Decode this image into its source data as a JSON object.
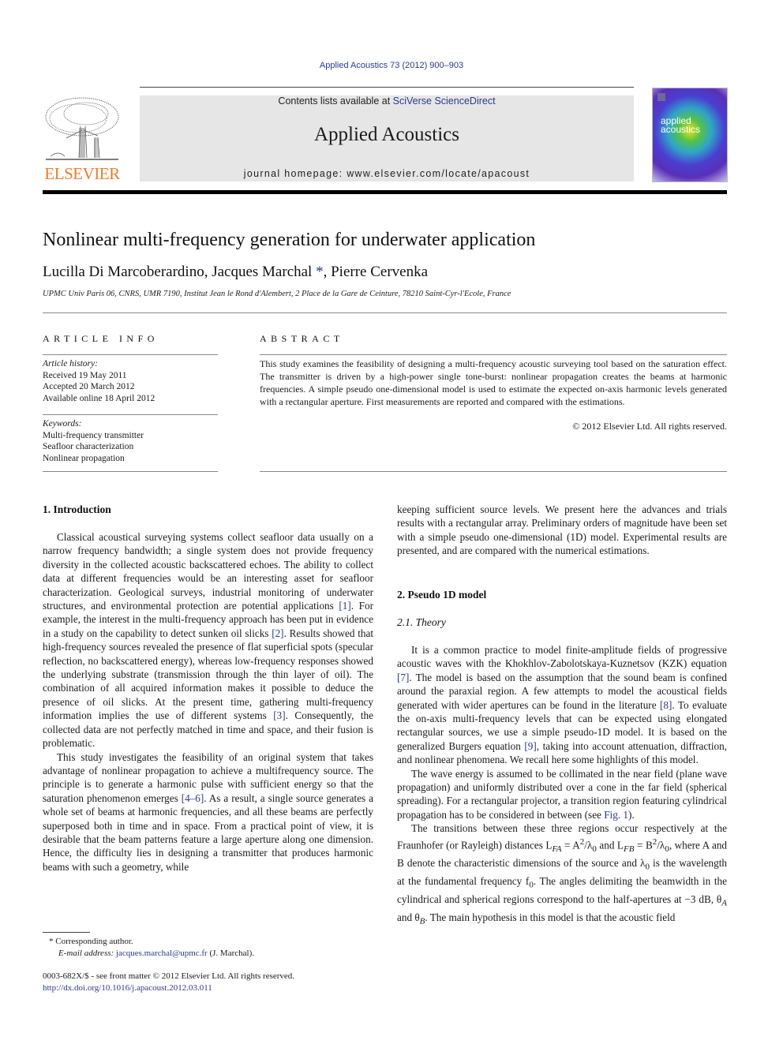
{
  "header": {
    "citation": "Applied Acoustics 73 (2012) 900–903",
    "publisher": "ELSEVIER",
    "contents_prefix": "Contents lists available at ",
    "contents_link": "SciVerse ScienceDirect",
    "journal_title": "Applied Acoustics",
    "homepage_prefix": "journal homepage: ",
    "homepage_url": "www.elsevier.com/locate/apacoust",
    "cover_title_line1": "applied",
    "cover_title_line2": "acoustics"
  },
  "article": {
    "title": "Nonlinear multi-frequency generation for underwater application",
    "authors": [
      {
        "name": "Lucilla Di Marcoberardino",
        "suffix": ", "
      },
      {
        "name": "Jacques Marchal",
        "mark": " *",
        "suffix": ", "
      },
      {
        "name": "Pierre Cervenka",
        "suffix": ""
      }
    ],
    "affiliation": "UPMC Univ Paris 06, CNRS, UMR 7190, Institut Jean le Rond d'Alembert, 2 Place de la Gare de Ceinture, 78210 Saint-Cyr-l'Ecole, France"
  },
  "article_info": {
    "heading": "ARTICLE INFO",
    "history_label": "Article history:",
    "history": [
      "Received 19 May 2011",
      "Accepted 20 March 2012",
      "Available online 18 April 2012"
    ],
    "keywords_label": "Keywords:",
    "keywords": [
      "Multi-frequency transmitter",
      "Seafloor characterization",
      "Nonlinear propagation"
    ]
  },
  "abstract": {
    "heading": "ABSTRACT",
    "text": "This study examines the feasibility of designing a multi-frequency acoustic surveying tool based on the saturation effect. The transmitter is driven by a high-power single tone-burst: nonlinear propagation creates the beams at harmonic frequencies. A simple pseudo one-dimensional model is used to estimate the expected on-axis harmonic levels generated with a rectangular aperture. First measurements are reported and compared with the estimations.",
    "copyright": "© 2012 Elsevier Ltd. All rights reserved."
  },
  "body": {
    "sec1_heading": "1. Introduction",
    "sec1_p1_a": "Classical acoustical surveying systems collect seafloor data usually on a narrow frequency bandwidth; a single system does not provide frequency diversity in the collected acoustic backscattered echoes. The ability to collect data at different frequencies would be an interesting asset for seafloor characterization. Geological surveys, industrial monitoring of underwater structures, and environmental protection are potential applications ",
    "ref1": "[1]",
    "sec1_p1_b": ". For example, the interest in the multi-frequency approach has been put in evidence in a study on the capability to detect sunken oil slicks ",
    "ref2": "[2]",
    "sec1_p1_c": ". Results showed that high-frequency sources revealed the presence of flat superficial spots (specular reflection, no backscattered energy), whereas low-frequency responses showed the underlying substrate (transmission through the thin layer of oil). The combination of all acquired information makes it possible to deduce the presence of oil slicks. At the present time, gathering multi-frequency information implies the use of different systems ",
    "ref3": "[3]",
    "sec1_p1_d": ". Consequently, the collected data are not perfectly matched in time and space, and their fusion is problematic.",
    "sec1_p2_a": "This study investigates the feasibility of an original system that takes advantage of nonlinear propagation to achieve a multifrequency source. The principle is to generate a harmonic pulse with sufficient energy so that the saturation phenomenon emerges ",
    "ref4_6": "[4–6]",
    "sec1_p2_b": ". As a result, a single source generates a whole set of beams at harmonic frequencies, and all these beams are perfectly superposed both in time and in space. From a practical point of view, it is desirable that the beam patterns feature a large aperture along one dimension. Hence, the difficulty lies in designing a transmitter that produces harmonic beams with such a geometry, while keeping sufficient source levels. We present here the advances and trials results with a rectangular array. Preliminary orders of magnitude have been set with a simple pseudo one-dimensional (1D) model. Experimental results are presented, and are compared with the numerical estimations.",
    "sec2_heading": "2. Pseudo 1D model",
    "sec21_heading": "2.1. Theory",
    "sec21_p1_a": "It is a common practice to model finite-amplitude fields of progressive acoustic waves with the Khokhlov-Zabolotskaya-Kuznetsov (KZK) equation ",
    "ref7": "[7]",
    "sec21_p1_b": ". The model is based on the assumption that the sound beam is confined around the paraxial region. A few attempts to model the acoustical fields generated with wider apertures can be found in the literature ",
    "ref8": "[8]",
    "sec21_p1_c": ". To evaluate the on-axis multi-frequency levels that can be expected using elongated rectangular sources, we use a simple pseudo-1D model. It is based on the generalized Burgers equation ",
    "ref9": "[9]",
    "sec21_p1_d": ", taking into account attenuation, diffraction, and nonlinear phenomena. We recall here some highlights of this model.",
    "sec21_p2_a": "The wave energy is assumed to be collimated in the near field (plane wave propagation) and uniformly distributed over a cone in the far field (spherical spreading). For a rectangular projector, a transition region featuring cylindrical propagation has to be considered in between (see ",
    "fig1": "Fig. 1",
    "sec21_p2_b": ").",
    "sec21_p3_a": "The transitions between these three regions occur respectively at the Fraunhofer (or Rayleigh) distances L",
    "sub_FA": "FA",
    "eq_FA": " = A",
    "eq_FA_tail": "/λ",
    "sub0": "0",
    "and": " and L",
    "sub_FB": "FB",
    "eq_FB": " = B",
    "sup2": "2",
    "sec21_p3_b": ", where A and B denote the characteristic dimensions of the source and λ",
    "sec21_p3_c": " is the wavelength at the fundamental frequency f",
    "sec21_p3_d": ". The angles delimiting the beamwidth in the cylindrical and spherical regions correspond to the half-apertures at −3 dB, θ",
    "sub_A": "A",
    "sec21_p3_e": " and θ",
    "sub_B": "B",
    "sec21_p3_f": ". The main hypothesis in this model is that the acoustic field"
  },
  "footnotes": {
    "star": "*",
    "corresponding": "Corresponding author.",
    "email_label": "E-mail address: ",
    "email": "jacques.marchal@upmc.fr",
    "email_suffix": " (J. Marchal).",
    "issn_line": "0003-682X/$ - see front matter © 2012 Elsevier Ltd. All rights reserved.",
    "doi": "http://dx.doi.org/10.1016/j.apacoust.2012.03.011"
  },
  "colors": {
    "link": "#2a3a8c",
    "elsevier_orange": "#f07c2a",
    "banner_bg": "#e6e6e6"
  }
}
